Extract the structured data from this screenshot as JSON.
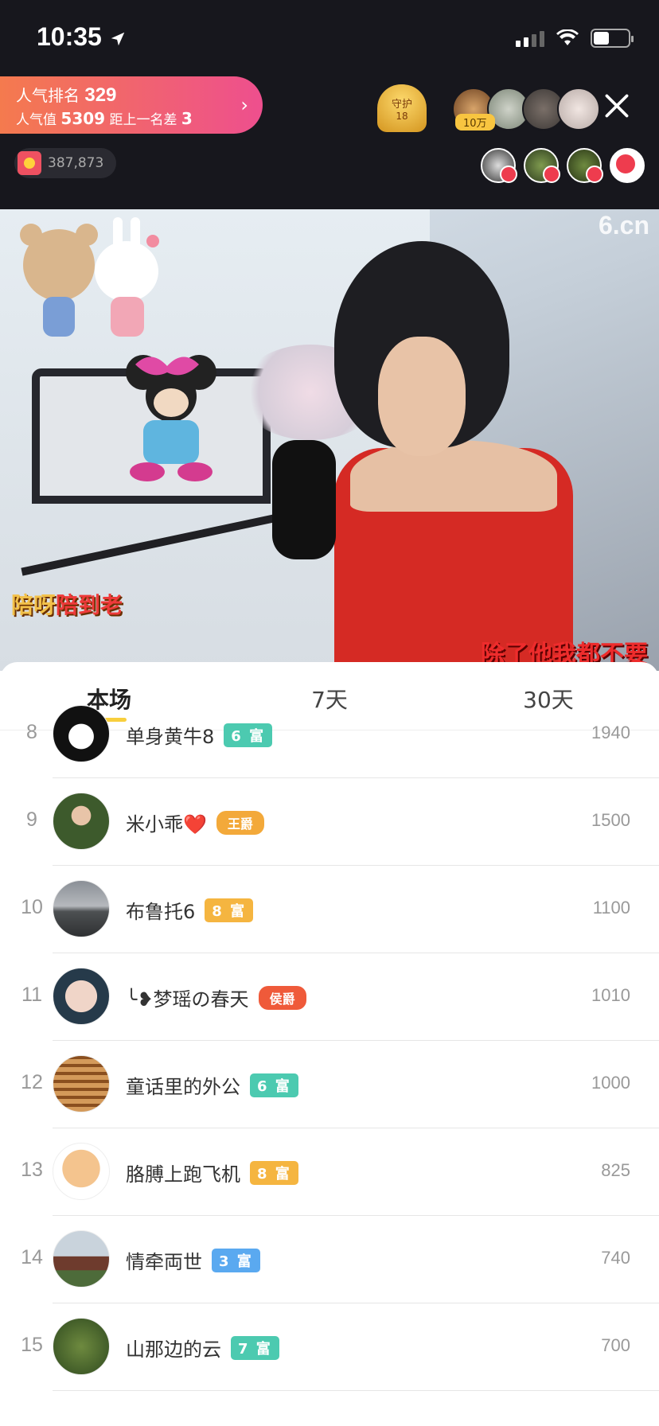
{
  "status": {
    "time": "10:35"
  },
  "header": {
    "rank_label": "人气排名",
    "rank_value": "329",
    "pop_label": "人气值",
    "pop_value": "5309",
    "gap_label": "距上一名差",
    "gap_value": "3",
    "coins": "387,873",
    "guard_label": "守护",
    "guard_count": "18",
    "top_viewer_badge": "10万"
  },
  "video": {
    "watermark": "6.cn",
    "caption_left_a": "陪呀",
    "caption_left_b": "陪到老",
    "caption_right": "除了他我都不要"
  },
  "tabs": [
    {
      "label": "本场",
      "active": true
    },
    {
      "label": "7天",
      "active": false
    },
    {
      "label": "30天",
      "active": false
    }
  ],
  "rows": [
    {
      "rank": "8",
      "name": "单身黄牛8",
      "badge": "6 富",
      "badge_color": "#4ccab0",
      "score": "1940",
      "avatar": "penguin"
    },
    {
      "rank": "9",
      "name": "米小乖❤️",
      "badge": "王爵",
      "badge_color": "#f3a93a",
      "score": "1500",
      "avatar": "photo-girl"
    },
    {
      "rank": "10",
      "name": "布鲁托6",
      "badge": "8 富",
      "badge_color": "#f5b540",
      "score": "1100",
      "avatar": "sunset"
    },
    {
      "rank": "11",
      "name": "╰❥梦瑶の春天",
      "badge": "侯爵",
      "badge_color": "#ef5a3a",
      "score": "1010",
      "avatar": "glasses"
    },
    {
      "rank": "12",
      "name": "童话里的外公",
      "badge": "6 富",
      "badge_color": "#4ccab0",
      "score": "1000",
      "avatar": "pagoda"
    },
    {
      "rank": "13",
      "name": "胳膊上跑飞机",
      "badge": "8 富",
      "badge_color": "#f5b540",
      "score": "825",
      "avatar": "cartoon"
    },
    {
      "rank": "14",
      "name": "情牵両世",
      "badge": "3 富",
      "badge_color": "#5aa9f0",
      "score": "740",
      "avatar": "flowers"
    },
    {
      "rank": "15",
      "name": "山那边的云",
      "badge": "7 富",
      "badge_color": "#4ccab0",
      "score": "700",
      "avatar": "leaves"
    }
  ]
}
